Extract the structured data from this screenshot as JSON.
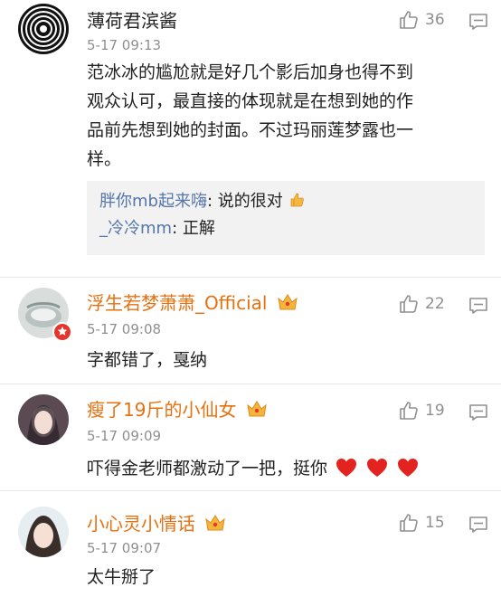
{
  "comments": [
    {
      "username": "薄荷君滨酱",
      "timestamp": "5-17 09:13",
      "likes": "36",
      "text_lines": [
        "范冰冰的尴尬就是好几个影后加身也得不到",
        "观众认可，最直接的体现就是在想到她的作",
        "品前先想到她的封面。不过玛丽莲梦露也一",
        "样。"
      ],
      "replies": [
        {
          "name": "胖你mb起来嗨",
          "text": ": 说的很对"
        },
        {
          "name": "_冷冷mm",
          "text": ": 正解"
        }
      ]
    },
    {
      "username": "浮生若梦萧萧_Official",
      "timestamp": "5-17 09:08",
      "likes": "22",
      "text": "字都错了，戛纳"
    },
    {
      "username": "瘦了19斤的小仙女",
      "timestamp": "5-17 09:09",
      "likes": "19",
      "text": "吓得金老师都激动了一把，挺你"
    },
    {
      "username": "小心灵小情话",
      "timestamp": "5-17 09:07",
      "likes": "15",
      "text": "太牛掰了"
    }
  ],
  "colors": {
    "member_name": "#e7700f",
    "reply_name": "#5576a8",
    "muted": "#8f8f8f",
    "heart": "#e3231f"
  },
  "icons": [
    "thumbs-up-icon",
    "comment-menu-icon",
    "vip-crown-icon",
    "heart-icon",
    "thumbs-up-emoji-icon"
  ]
}
